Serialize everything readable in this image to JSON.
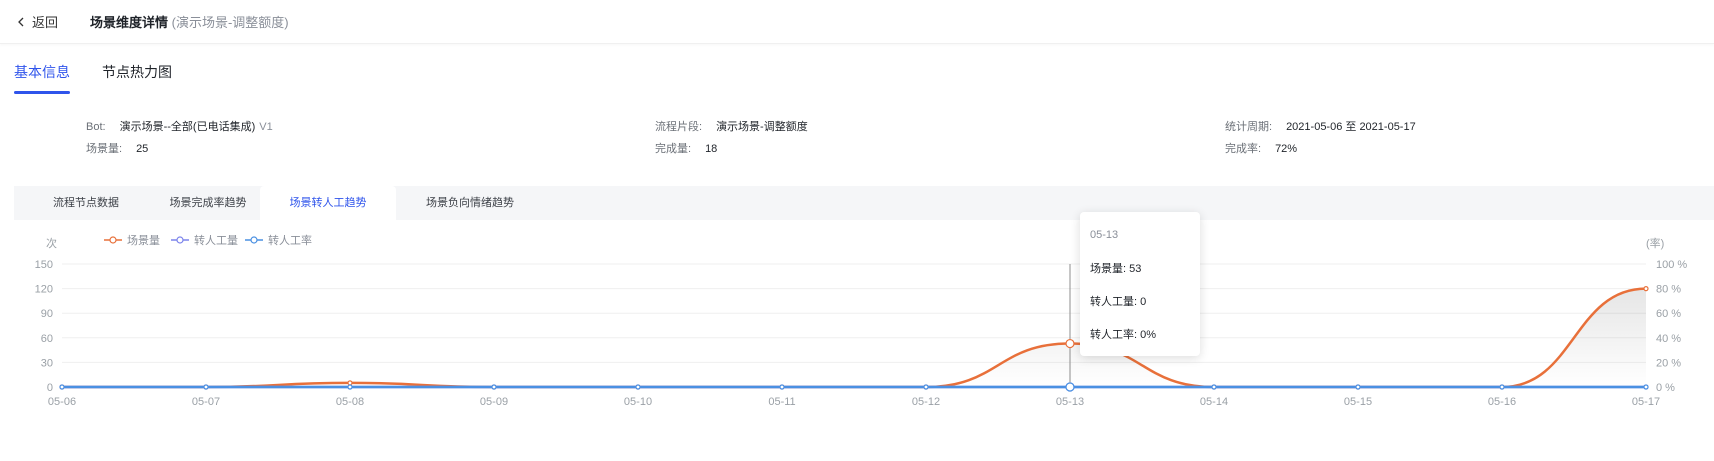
{
  "header": {
    "back_label": "返回",
    "title": "场景维度详情",
    "subtitle": "(演示场景-调整额度)"
  },
  "tabs": [
    {
      "label": "基本信息",
      "active": true
    },
    {
      "label": "节点热力图",
      "active": false
    }
  ],
  "info": {
    "bot_label": "Bot:",
    "bot_value": "演示场景--全部(已电话集成)",
    "bot_version": "V1",
    "flow_label": "流程片段:",
    "flow_value": "演示场景-调整额度",
    "period_label": "统计周期:",
    "period_value": "2021-05-06 至 2021-05-17",
    "scene_count_label": "场景量:",
    "scene_count_value": "25",
    "complete_count_label": "完成量:",
    "complete_count_value": "18",
    "complete_rate_label": "完成率:",
    "complete_rate_value": "72%"
  },
  "subtabs": [
    {
      "label": "流程节点数据",
      "active": false
    },
    {
      "label": "场景完成率趋势",
      "active": false
    },
    {
      "label": "场景转人工趋势",
      "active": true
    },
    {
      "label": "场景负向情绪趋势",
      "active": false
    }
  ],
  "tooltip": {
    "date": "05-13",
    "scene_label": "场景量:",
    "scene_value": "53",
    "transfer_label": "转人工量:",
    "transfer_value": "0",
    "rate_label": "转人工率:",
    "rate_value": "0%"
  },
  "colors": {
    "accent": "#2f54eb",
    "scene_series": "#e8703a",
    "transfer_series": "#7b83eb",
    "rate_series": "#4a90e2"
  },
  "chart_data": {
    "type": "line",
    "x": [
      "05-06",
      "05-07",
      "05-08",
      "05-09",
      "05-10",
      "05-11",
      "05-12",
      "05-13",
      "05-14",
      "05-15",
      "05-16",
      "05-17"
    ],
    "y_left_unit": "次",
    "y_right_unit": "(率)",
    "y_left_ticks": [
      "150",
      "120",
      "90",
      "60",
      "30",
      "0"
    ],
    "y_right_ticks": [
      "100 %",
      "80 %",
      "60 %",
      "40 %",
      "20 %",
      "0 %"
    ],
    "ylim_left": [
      0,
      150
    ],
    "ylim_right": [
      0,
      100
    ],
    "grid": true,
    "legend_position": "top-left",
    "highlight_index": 7,
    "series": [
      {
        "name": "场景量",
        "axis": "left",
        "values": [
          0,
          0,
          5,
          0,
          0,
          0,
          0,
          53,
          0,
          0,
          0,
          120
        ]
      },
      {
        "name": "转人工量",
        "axis": "left",
        "values": [
          0,
          0,
          0,
          0,
          0,
          0,
          0,
          0,
          0,
          0,
          0,
          0
        ]
      },
      {
        "name": "转人工率",
        "axis": "right",
        "values": [
          0,
          0,
          0,
          0,
          0,
          0,
          0,
          0,
          0,
          0,
          0,
          0
        ]
      }
    ]
  }
}
